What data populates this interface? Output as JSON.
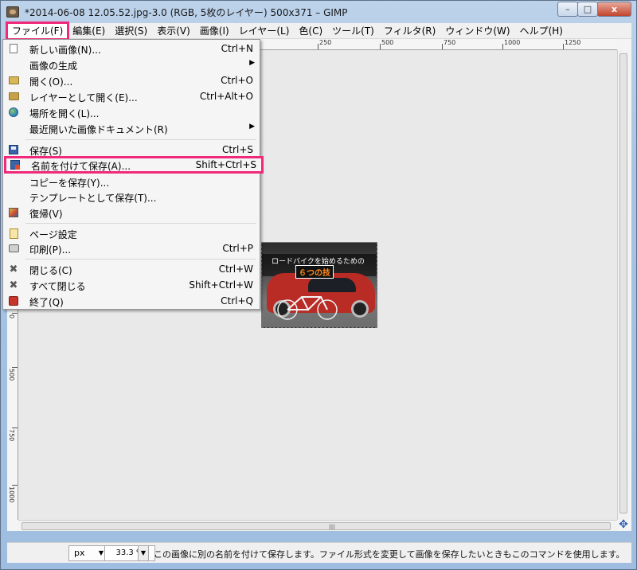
{
  "window": {
    "title": "*2014-06-08 12.05.52.jpg-3.0 (RGB, 5枚のレイヤー) 500x371 – GIMP",
    "minimize_label": "–",
    "maximize_label": "□",
    "close_label": "x"
  },
  "menubar": {
    "items": [
      {
        "label": "ファイル(F)"
      },
      {
        "label": "編集(E)"
      },
      {
        "label": "選択(S)"
      },
      {
        "label": "表示(V)"
      },
      {
        "label": "画像(I)"
      },
      {
        "label": "レイヤー(L)"
      },
      {
        "label": "色(C)"
      },
      {
        "label": "ツール(T)"
      },
      {
        "label": "フィルタ(R)"
      },
      {
        "label": "ウィンドウ(W)"
      },
      {
        "label": "ヘルプ(H)"
      }
    ],
    "active_index": 0
  },
  "file_menu": {
    "items": [
      {
        "label": "新しい画像(N)...",
        "shortcut": "Ctrl+N",
        "icon": "new-image-icon"
      },
      {
        "label": "画像の生成",
        "shortcut": "",
        "submenu": true,
        "icon": ""
      },
      {
        "label": "開く(O)...",
        "shortcut": "Ctrl+O",
        "icon": "folder-icon"
      },
      {
        "label": "レイヤーとして開く(E)...",
        "shortcut": "Ctrl+Alt+O",
        "icon": "open-layer-icon"
      },
      {
        "label": "場所を開く(L)...",
        "shortcut": "",
        "icon": "globe-icon"
      },
      {
        "label": "最近開いた画像ドキュメント(R)",
        "shortcut": "",
        "submenu": true,
        "icon": ""
      },
      {
        "label": "保存(S)",
        "shortcut": "Ctrl+S",
        "icon": "save-icon"
      },
      {
        "label": "名前を付けて保存(A)...",
        "shortcut": "Shift+Ctrl+S",
        "icon": "save-as-icon",
        "highlighted": true
      },
      {
        "label": "コピーを保存(Y)...",
        "shortcut": "",
        "icon": ""
      },
      {
        "label": "テンプレートとして保存(T)...",
        "shortcut": "",
        "icon": ""
      },
      {
        "label": "復帰(V)",
        "shortcut": "",
        "icon": "revert-icon"
      },
      {
        "label": "ページ設定",
        "shortcut": "",
        "icon": "page-setup-icon"
      },
      {
        "label": "印刷(P)...",
        "shortcut": "Ctrl+P",
        "icon": "print-icon"
      },
      {
        "label": "閉じる(C)",
        "shortcut": "Ctrl+W",
        "icon": "close-x-icon"
      },
      {
        "label": "すべて閉じる",
        "shortcut": "Shift+Ctrl+W",
        "icon": "close-all-x-icon"
      },
      {
        "label": "終了(Q)",
        "shortcut": "Ctrl+Q",
        "icon": "quit-icon"
      }
    ],
    "submenu_arrow": "▶"
  },
  "ruler": {
    "top_labels": [
      "250",
      "500",
      "750",
      "1000",
      "1250"
    ],
    "left_labels": [
      "0",
      "500",
      "750",
      "1000"
    ]
  },
  "image": {
    "caption": "ロードバイクを始めるための",
    "subtitle": "６つの技"
  },
  "statusbar": {
    "unit": "px",
    "zoom": "33.3 %",
    "message": "この画像に別の名前を付けて保存します。ファイル形式を変更して画像を保存したいときもこのコマンドを使用します。"
  },
  "scroll": {
    "grip": "III",
    "navigate_icon": "✥"
  },
  "colors": {
    "highlight": "#f0297a",
    "menu_bg": "#f5f5f5"
  }
}
